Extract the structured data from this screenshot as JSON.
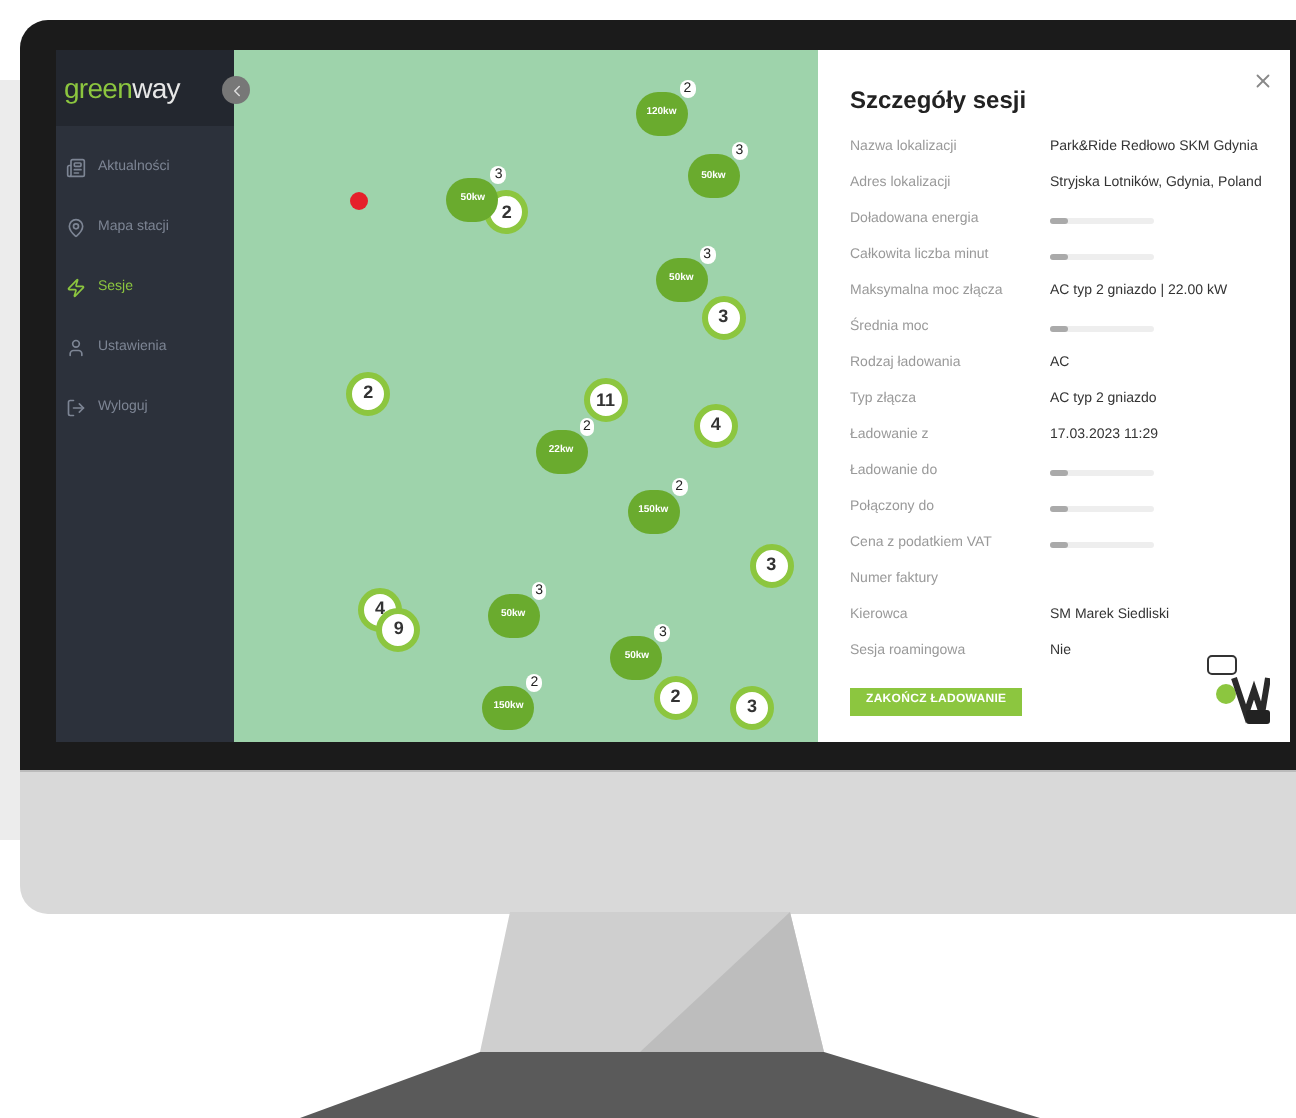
{
  "logo": {
    "green_part": "green",
    "white_part": "way"
  },
  "sidebar": {
    "items": [
      {
        "label": "Aktualności",
        "selected": false
      },
      {
        "label": "Mapa stacji",
        "selected": false
      },
      {
        "label": "Sesje",
        "selected": true
      },
      {
        "label": "Ustawienia",
        "selected": false
      },
      {
        "label": "Wyloguj",
        "selected": false
      }
    ]
  },
  "map": {
    "markers": [
      {
        "kind": "cluster",
        "count": "2"
      },
      {
        "kind": "cluster",
        "count": "3"
      },
      {
        "kind": "cluster",
        "count": "2"
      },
      {
        "kind": "cluster",
        "count": "11"
      },
      {
        "kind": "cluster",
        "count": "4"
      },
      {
        "kind": "cluster",
        "count": "3"
      },
      {
        "kind": "cluster",
        "count": "4"
      },
      {
        "kind": "cluster",
        "count": "9"
      },
      {
        "kind": "cluster",
        "count": "2"
      },
      {
        "kind": "cluster",
        "count": "3"
      },
      {
        "kind": "station",
        "power": "50kw",
        "count": "3"
      },
      {
        "kind": "station",
        "power": "120kw",
        "count": "2"
      },
      {
        "kind": "station",
        "power": "50kw",
        "count": "3"
      },
      {
        "kind": "station",
        "power": "50kw",
        "count": "3"
      },
      {
        "kind": "station",
        "power": "22kw",
        "count": "2"
      },
      {
        "kind": "station",
        "power": "150kw",
        "count": "2"
      },
      {
        "kind": "station",
        "power": "50kw",
        "count": "3"
      },
      {
        "kind": "station",
        "power": "50kw",
        "count": "3"
      },
      {
        "kind": "station",
        "power": "150kw",
        "count": "2"
      }
    ]
  },
  "details": {
    "title": "Szczegóły sesji",
    "rows": [
      {
        "label": "Nazwa lokalizacji",
        "kind": "text",
        "value": "Park&Ride Redłowo SKM Gdynia"
      },
      {
        "label": "Adres lokalizacji",
        "kind": "text",
        "value": "Stryjska Lotników, Gdynia, Poland"
      },
      {
        "label": "Doładowana energia",
        "kind": "loading"
      },
      {
        "label": "Całkowita liczba minut",
        "kind": "loading"
      },
      {
        "label": "Maksymalna moc złącza",
        "kind": "text",
        "value": "AC typ 2 gniazdo | 22.00 kW"
      },
      {
        "label": "Średnia moc",
        "kind": "loading"
      },
      {
        "label": "Rodzaj ładowania",
        "kind": "text",
        "value": "AC"
      },
      {
        "label": "Typ złącza",
        "kind": "text",
        "value": "AC typ 2 gniazdo"
      },
      {
        "label": "Ładowanie z",
        "kind": "text",
        "value": "17.03.2023 11:29"
      },
      {
        "label": "Ładowanie do",
        "kind": "loading"
      },
      {
        "label": "Połączony do",
        "kind": "loading"
      },
      {
        "label": "Cena z podatkiem VAT",
        "kind": "loading"
      },
      {
        "label": "Numer faktury",
        "kind": "blank"
      },
      {
        "label": "Kierowca",
        "kind": "text",
        "value": "SM Marek Siedliski"
      },
      {
        "label": "Sesja roamingowa",
        "kind": "text",
        "value": "Nie"
      }
    ],
    "button": "ZAKOŃCZ ŁADOWANIE"
  }
}
